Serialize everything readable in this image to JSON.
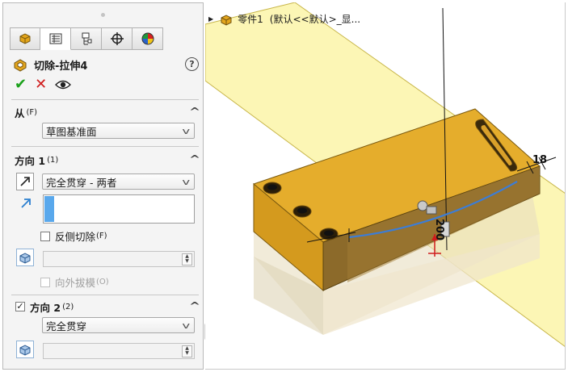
{
  "tabs": [
    {
      "name": "featuremanager-tab",
      "icon": "featuremanager-icon"
    },
    {
      "name": "propertymanager-tab",
      "icon": "propertymanager-icon"
    },
    {
      "name": "configurationmanager-tab",
      "icon": "configurationmanager-icon"
    },
    {
      "name": "dimxpertmanager-tab",
      "icon": "crosshair-icon"
    },
    {
      "name": "displaymanager-tab",
      "icon": "color-wheel-icon"
    }
  ],
  "feature": {
    "title": "切除-拉伸4",
    "help": "?"
  },
  "actions": {
    "ok": "✔",
    "cancel": "✕",
    "preview": "eye-icon"
  },
  "from": {
    "heading": "从",
    "shortcut": "(F)",
    "value": "草图基准面"
  },
  "direction1": {
    "heading": "方向 1",
    "shortcut": "(1)",
    "end_condition": "完全贯穿 - 两者",
    "flip_side_label": "反侧切除",
    "flip_side_shortcut": "(F)",
    "draft_outward_label": "向外拔模",
    "draft_outward_shortcut": "(O)"
  },
  "direction2": {
    "heading": "方向 2",
    "shortcut": "(2)",
    "checked": true,
    "end_condition": "完全贯穿"
  },
  "viewport": {
    "part_name": "零件1",
    "config": "(默认<<默认>_显...",
    "dim_18": "18",
    "dim_200": "200"
  },
  "colors": {
    "plane": "#fbf5a8",
    "part_top": "#e5ad2c",
    "part_front": "#8c6a2a",
    "sketch": "#3c7dd6",
    "accent_check": "#1ba11b",
    "accent_cancel": "#d01c1c"
  }
}
